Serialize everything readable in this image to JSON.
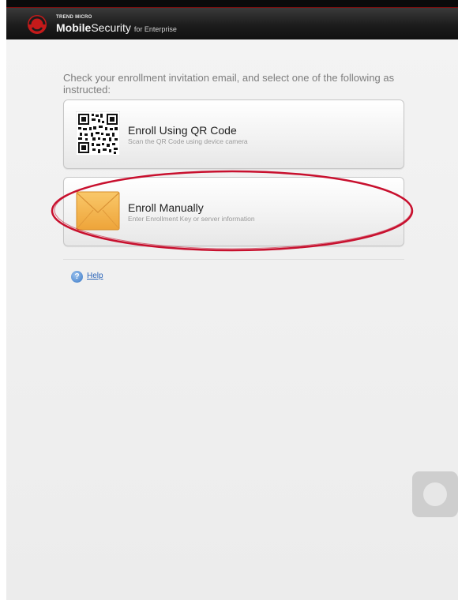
{
  "header": {
    "brand_small": "TREND MICRO",
    "brand_main_bold": "Mobile",
    "brand_main_rest": "Security",
    "brand_suffix": "for Enterprise"
  },
  "instructions": "Check your enrollment invitation email, and select one of the following as instructed:",
  "options": [
    {
      "title": "Enroll Using QR Code",
      "subtitle": "Scan the QR Code using device camera",
      "icon": "qr-code-icon"
    },
    {
      "title": "Enroll Manually",
      "subtitle": "Enter Enrollment Key or server information",
      "icon": "envelope-icon"
    }
  ],
  "help": {
    "label": "Help",
    "icon": "help-icon"
  },
  "colors": {
    "header_bg": "#1c1c1c",
    "brand_red": "#c41a1a",
    "highlight_ring": "#c8102e",
    "link": "#2a63b8"
  }
}
